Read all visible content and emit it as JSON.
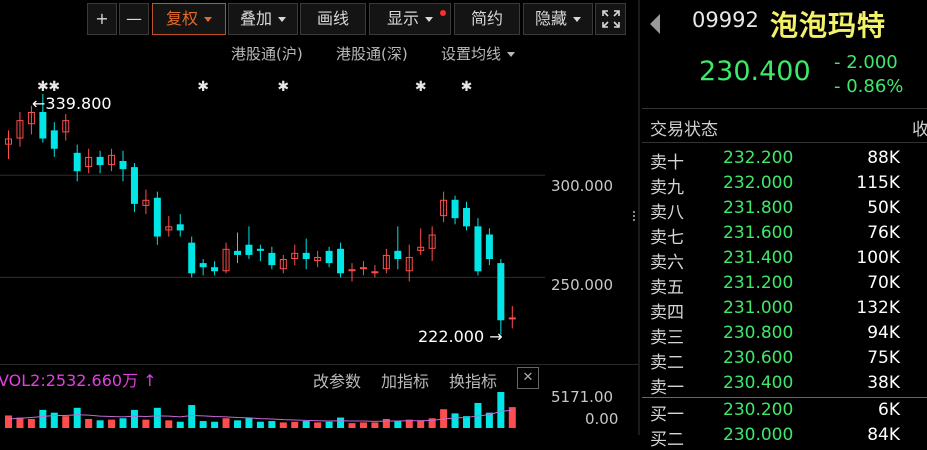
{
  "toolbar": {
    "plus": "+",
    "minus": "—",
    "restore_rights": "复权",
    "overlay": "叠加",
    "draw_line": "画线",
    "display": "显示",
    "simple": "简约",
    "hide": "隐藏"
  },
  "chart_links": {
    "hk_connect_sh": "港股通(沪)",
    "hk_connect_sz": "港股通(深)",
    "ma_settings": "设置均线"
  },
  "price_axis": {
    "label_300": "300.000",
    "label_250": "250.000"
  },
  "annotations": {
    "high": "339.800",
    "low": "222.000"
  },
  "event_marker_glyph": "✱",
  "volume": {
    "indicator_text": "VOL2:2532.660万 ↑",
    "modify_params": "改参数",
    "add_indicator": "加指标",
    "change_indicator": "换指标",
    "close": "✕",
    "axis_top": "5171.00",
    "axis_zero": "0.00"
  },
  "quote": {
    "code": "09992",
    "name": "泡泡玛特",
    "price": "230.400",
    "change": "- 2.000",
    "change_pct": "- 0.86%",
    "trade_status": "交易状态",
    "cut_label": "收",
    "colors": {
      "up": "#3ee86a",
      "name": "#f3f06a"
    }
  },
  "order_book": [
    {
      "label": "卖十",
      "price": "232.200",
      "volume": "88K"
    },
    {
      "label": "卖九",
      "price": "232.000",
      "volume": "115K"
    },
    {
      "label": "卖八",
      "price": "231.800",
      "volume": "50K"
    },
    {
      "label": "卖七",
      "price": "231.600",
      "volume": "76K"
    },
    {
      "label": "卖六",
      "price": "231.400",
      "volume": "100K"
    },
    {
      "label": "卖五",
      "price": "231.200",
      "volume": "70K"
    },
    {
      "label": "卖四",
      "price": "231.000",
      "volume": "132K"
    },
    {
      "label": "卖三",
      "price": "230.800",
      "volume": "94K"
    },
    {
      "label": "卖二",
      "price": "230.600",
      "volume": "75K"
    },
    {
      "label": "卖一",
      "price": "230.400",
      "volume": "38K"
    },
    {
      "label": "买一",
      "price": "230.200",
      "volume": "6K"
    },
    {
      "label": "买二",
      "price": "230.000",
      "volume": "84K"
    }
  ],
  "chart_data": {
    "type": "candlestick",
    "ylim": [
      212,
      354
    ],
    "colors": {
      "up": "#ff4d4d",
      "down": "#00e5e5"
    },
    "candles": [
      {
        "o": 315,
        "c": 318,
        "h": 322,
        "l": 308
      },
      {
        "o": 318,
        "c": 327,
        "h": 331,
        "l": 314
      },
      {
        "o": 325,
        "c": 331,
        "h": 334,
        "l": 320
      },
      {
        "o": 331,
        "c": 318,
        "h": 339.8,
        "l": 316
      },
      {
        "o": 322,
        "c": 313,
        "h": 326,
        "l": 309
      },
      {
        "o": 321,
        "c": 327,
        "h": 330,
        "l": 317
      },
      {
        "o": 311,
        "c": 302,
        "h": 315,
        "l": 297
      },
      {
        "o": 304,
        "c": 309,
        "h": 313,
        "l": 301
      },
      {
        "o": 309,
        "c": 305,
        "h": 312,
        "l": 301
      },
      {
        "o": 305,
        "c": 310,
        "h": 313,
        "l": 302
      },
      {
        "o": 307,
        "c": 303,
        "h": 312,
        "l": 297
      },
      {
        "o": 304,
        "c": 286,
        "h": 306,
        "l": 282
      },
      {
        "o": 285,
        "c": 288,
        "h": 293,
        "l": 281
      },
      {
        "o": 289,
        "c": 270,
        "h": 292,
        "l": 266
      },
      {
        "o": 273,
        "c": 275,
        "h": 280,
        "l": 270
      },
      {
        "o": 276,
        "c": 273,
        "h": 281,
        "l": 270
      },
      {
        "o": 267,
        "c": 252,
        "h": 270,
        "l": 250
      },
      {
        "o": 257,
        "c": 255,
        "h": 259,
        "l": 251
      },
      {
        "o": 255,
        "c": 253,
        "h": 258,
        "l": 251
      },
      {
        "o": 253,
        "c": 264,
        "h": 267,
        "l": 252
      },
      {
        "o": 263,
        "c": 261,
        "h": 272,
        "l": 257
      },
      {
        "o": 266,
        "c": 261,
        "h": 275,
        "l": 259
      },
      {
        "o": 264,
        "c": 263,
        "h": 266,
        "l": 258
      },
      {
        "o": 262,
        "c": 256,
        "h": 265,
        "l": 254
      },
      {
        "o": 254,
        "c": 259,
        "h": 261,
        "l": 252
      },
      {
        "o": 259,
        "c": 262,
        "h": 266,
        "l": 256
      },
      {
        "o": 262,
        "c": 259,
        "h": 269,
        "l": 254
      },
      {
        "o": 258,
        "c": 260,
        "h": 263,
        "l": 255
      },
      {
        "o": 263,
        "c": 257,
        "h": 265,
        "l": 255
      },
      {
        "o": 264,
        "c": 252,
        "h": 267,
        "l": 250
      },
      {
        "o": 253,
        "c": 254,
        "h": 257,
        "l": 248
      },
      {
        "o": 254,
        "c": 255,
        "h": 258,
        "l": 251
      },
      {
        "o": 253,
        "c": 253,
        "h": 256,
        "l": 250
      },
      {
        "o": 254,
        "c": 261,
        "h": 264,
        "l": 252
      },
      {
        "o": 263,
        "c": 259,
        "h": 275,
        "l": 254
      },
      {
        "o": 253,
        "c": 260,
        "h": 266,
        "l": 248
      },
      {
        "o": 263,
        "c": 265,
        "h": 274,
        "l": 261
      },
      {
        "o": 264,
        "c": 271,
        "h": 275,
        "l": 258
      },
      {
        "o": 280,
        "c": 288,
        "h": 292,
        "l": 277
      },
      {
        "o": 288,
        "c": 279,
        "h": 290,
        "l": 276
      },
      {
        "o": 284,
        "c": 275,
        "h": 287,
        "l": 273
      },
      {
        "o": 275,
        "c": 253,
        "h": 279,
        "l": 251
      },
      {
        "o": 271,
        "c": 259,
        "h": 274,
        "l": 256
      },
      {
        "o": 257,
        "c": 229,
        "h": 259,
        "l": 222
      },
      {
        "o": 230,
        "c": 230.4,
        "h": 236,
        "l": 225
      }
    ],
    "volumes": [
      1800,
      1500,
      1300,
      2600,
      2200,
      1700,
      2900,
      1300,
      1100,
      1200,
      1400,
      2600,
      1200,
      2900,
      1100,
      900,
      3300,
      1000,
      900,
      1400,
      1100,
      1500,
      900,
      1000,
      800,
      900,
      1000,
      800,
      900,
      1500,
      700,
      800,
      800,
      1300,
      1000,
      1200,
      1100,
      1400,
      2700,
      2100,
      1700,
      3600,
      2200,
      5171,
      3000
    ],
    "vol_ma": [
      1300,
      1400,
      1500,
      1650,
      1800,
      1800,
      1900,
      1850,
      1700,
      1650,
      1600,
      1700,
      1650,
      1750,
      1700,
      1600,
      1800,
      1750,
      1650,
      1600,
      1500,
      1450,
      1350,
      1300,
      1200,
      1150,
      1100,
      1050,
      1000,
      1050,
      1000,
      1000,
      950,
      1000,
      1000,
      1050,
      1050,
      1100,
      1300,
      1450,
      1500,
      1750,
      1900,
      2400,
      2532.66
    ],
    "event_markers": [
      3,
      4,
      17,
      24,
      36,
      40
    ]
  }
}
